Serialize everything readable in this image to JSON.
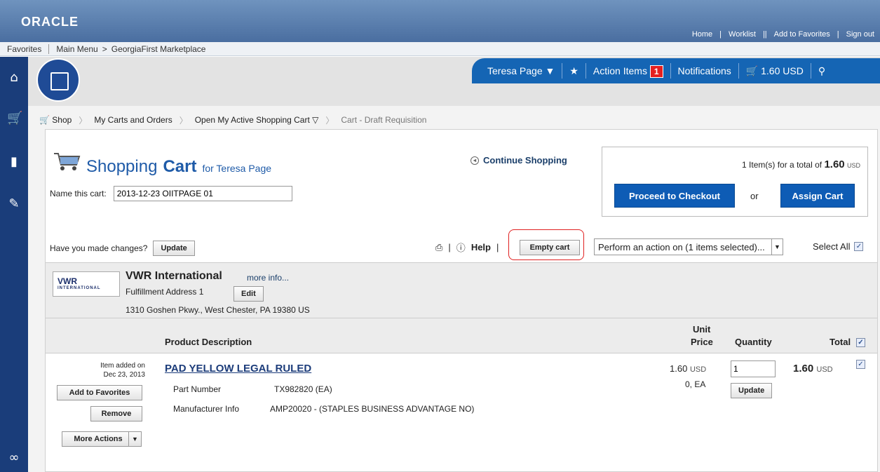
{
  "header": {
    "brand": "ORACLE",
    "links": [
      "Home",
      "Worklist",
      "Add to Favorites",
      "Sign out"
    ]
  },
  "nav": {
    "favorites": "Favorites",
    "main_menu": "Main Menu",
    "current": "GeorgiaFirst Marketplace"
  },
  "userbar": {
    "user": "Teresa Page",
    "action_items_label": "Action Items",
    "action_items_count": "1",
    "notifications": "Notifications",
    "cart_total": "1.60 USD"
  },
  "breadcrumb": {
    "shop": "Shop",
    "carts": "My Carts and Orders",
    "active": "Open My Active Shopping Cart",
    "current": "Cart - Draft Requisition"
  },
  "cart": {
    "title_light": "Shopping",
    "title_bold": "Cart",
    "title_for": "for Teresa Page",
    "name_label": "Name this cart:",
    "name_value": "2013-12-23 OIITPAGE 01",
    "continue": "Continue Shopping",
    "summary_pre": "1 Item(s)  for a total of",
    "summary_total": "1.60",
    "summary_currency": "USD",
    "proceed": "Proceed to Checkout",
    "or": "or",
    "assign": "Assign Cart",
    "changes_label": "Have you made changes?",
    "update": "Update",
    "help": "Help",
    "empty": "Empty cart",
    "action_select": "Perform an action on (1 items selected)...",
    "select_all": "Select All"
  },
  "supplier": {
    "logo": "VWR",
    "logo_sub": "INTERNATIONAL",
    "name": "VWR International",
    "more": "more info...",
    "address_label": "Fulfillment Address 1",
    "edit": "Edit",
    "address": "1310 Goshen Pkwy., West Chester, PA 19380 US"
  },
  "table": {
    "product": "Product Description",
    "unit": "Unit",
    "price": "Price",
    "quantity": "Quantity",
    "total": "Total"
  },
  "item": {
    "added_line1": "Item added on",
    "added_line2": "Dec 23, 2013",
    "name": "PAD YELLOW LEGAL RULED",
    "part_label": "Part Number",
    "part_value": "TX982820 (EA)",
    "mfr_label": "Manufacturer Info",
    "mfr_value": "AMP20020 - (STAPLES BUSINESS ADVANTAGE NO)",
    "unit_price": "1.60",
    "unit_currency": "USD",
    "unit_each": "0, EA",
    "quantity": "1",
    "update": "Update",
    "total": "1.60",
    "total_currency": "USD",
    "add_fav": "Add to Favorites",
    "remove": "Remove",
    "more_actions": "More Actions"
  }
}
